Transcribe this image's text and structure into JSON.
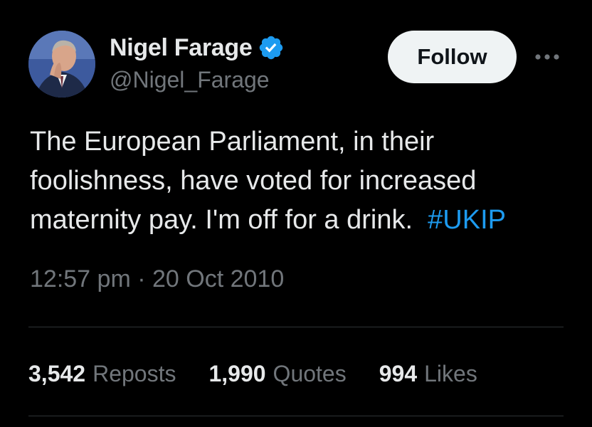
{
  "user": {
    "display_name": "Nigel Farage",
    "handle": "@Nigel_Farage",
    "verified_icon": "verified-badge-icon"
  },
  "follow_button": {
    "label": "Follow"
  },
  "more_icon": "more-horizontal-icon",
  "tweet": {
    "text": "The European Parliament, in their\nfoolishness, have voted for increased\nmaternity pay. I'm off for a drink.  ",
    "hashtag": "#UKIP"
  },
  "meta": {
    "time": "12:57 pm",
    "separator": " · ",
    "date": "20 Oct 2010"
  },
  "stats": {
    "reposts": {
      "count": "3,542",
      "label": "Reposts"
    },
    "quotes": {
      "count": "1,990",
      "label": "Quotes"
    },
    "likes": {
      "count": "994",
      "label": "Likes"
    }
  },
  "colors": {
    "background": "#000000",
    "text": "#e7e9ea",
    "muted": "#71767b",
    "accent": "#1d9bf0",
    "button_bg": "#eff3f4",
    "divider": "#2f3336"
  }
}
